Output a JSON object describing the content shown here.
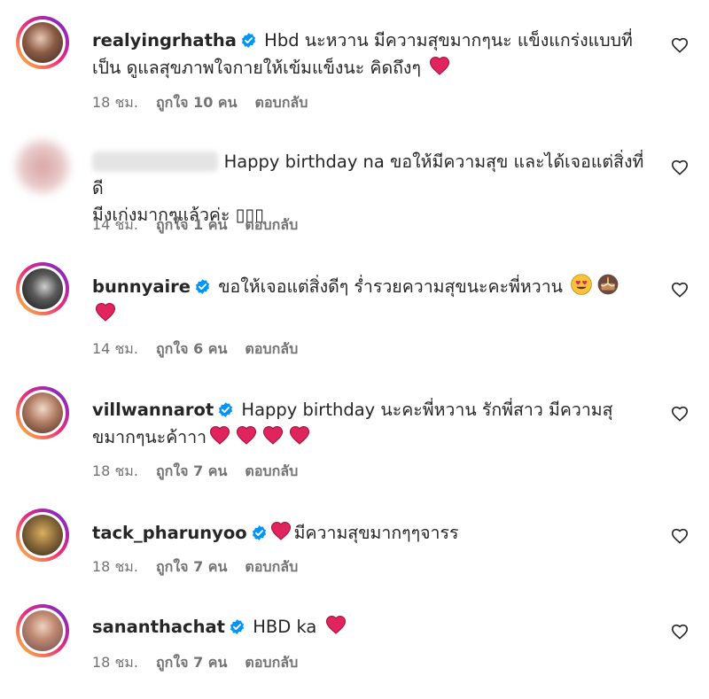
{
  "colors": {
    "verified": "#0095f6",
    "heart": "#e0245e",
    "meta": "#737373"
  },
  "comments": [
    {
      "username": "realyingrhatha",
      "verified": true,
      "text1": "Hbd นะหวาน มีความสุขมากๆนะ แข็งแกร่งแบบที่",
      "text2": "เป็น ดูแลสุขภาพใจกายให้เข้มแข็งนะ คิดถึงๆ",
      "time": "18 ชม.",
      "likes": "ถูกใจ 10 คน",
      "reply": "ตอบกลับ"
    },
    {
      "username": "",
      "verified": false,
      "text1": "Happy birthday na ขอให้มีความสุข และได้เจอแต่สิ่งที่ดี",
      "text2": "มีงเก่งมากๆแล้วค่ะ ▯▯▯",
      "time": "14 ชม.",
      "likes": "ถูกใจ 1 คน",
      "reply": "ตอบกลับ"
    },
    {
      "username": "bunnyaire",
      "verified": true,
      "text1": "ขอให้เจอแต่สิ่งดีๆ ร่ำรวยความสุขนะคะพี่หวาน",
      "text2": "",
      "time": "14 ชม.",
      "likes": "ถูกใจ 6 คน",
      "reply": "ตอบกลับ"
    },
    {
      "username": "villwannarot",
      "verified": true,
      "text1": "Happy birthday นะคะพี่หวาน รักพี่สาว มีความสุ",
      "text2": "ขมากๆนะค้าาา",
      "time": "18 ชม.",
      "likes": "ถูกใจ 7 คน",
      "reply": "ตอบกลับ"
    },
    {
      "username": "tack_pharunyoo",
      "verified": true,
      "text1": "มีความสุขมากๆๆจารร",
      "text2": "",
      "time": "18 ชม.",
      "likes": "ถูกใจ 7 คน",
      "reply": "ตอบกลับ"
    },
    {
      "username": "sananthachat",
      "verified": true,
      "text1": "HBD ka",
      "text2": "",
      "time": "18 ชม.",
      "likes": "ถูกใจ 7 คน",
      "reply": "ตอบกลับ"
    }
  ],
  "icons": {
    "verified": "verified-badge-icon",
    "heart_emoji": "red-heart-emoji",
    "heart_eyes": "heart-eyes-emoji",
    "cake": "birthday-cake-emoji",
    "like": "heart-outline-icon"
  }
}
